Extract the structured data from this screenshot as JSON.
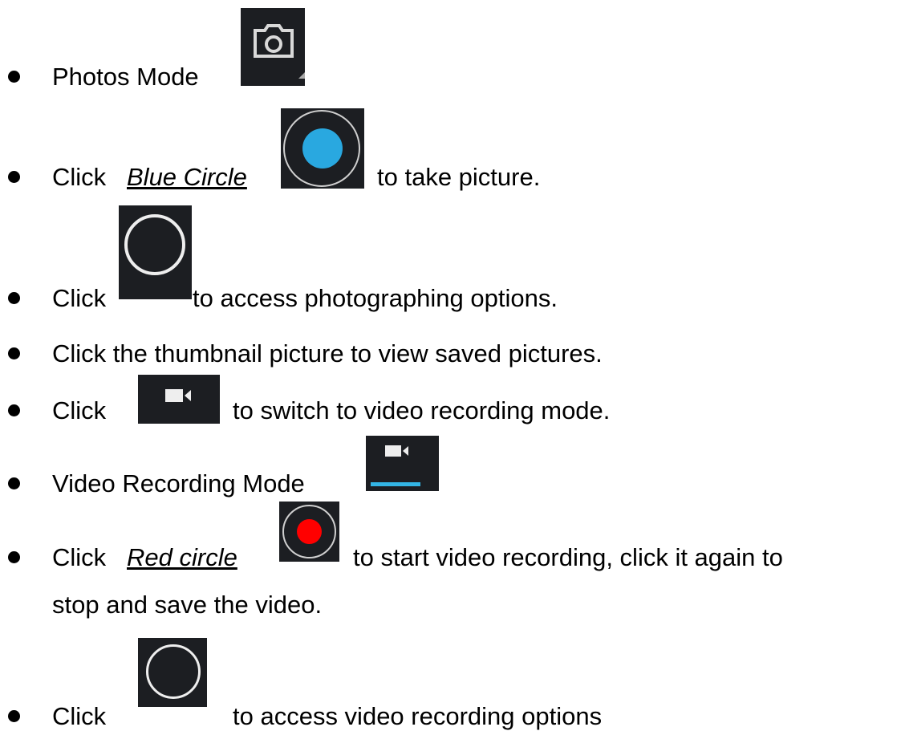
{
  "items": [
    {
      "text": "Photos Mode"
    },
    {
      "before": "Click",
      "link": "Blue Circle",
      "after": "to take picture."
    },
    {
      "before": "Click",
      "after": "to access photographing options."
    },
    {
      "text": "Click the thumbnail picture to view saved pictures."
    },
    {
      "before": "Click",
      "after": "to switch to video recording mode."
    },
    {
      "text": "Video Recording Mode"
    },
    {
      "before": "Click",
      "link": "Red circle",
      "after_line1": "to start video recording, click it again to",
      "after_line2": "stop and save the video."
    },
    {
      "before": "Click",
      "after": "to access video recording options"
    }
  ],
  "icons": {
    "camera": "camera-icon",
    "shutter_blue": "blue-shutter-icon",
    "options": "options-circle-icon",
    "video": "video-camera-icon",
    "video_mode": "video-mode-icon",
    "record_red": "red-record-icon"
  },
  "colors": {
    "icon_bg": "#1c1e22",
    "blue": "#29a8e0",
    "red": "#ff0000",
    "ring": "#d9d9d9",
    "tab_underline": "#33b5e5"
  }
}
